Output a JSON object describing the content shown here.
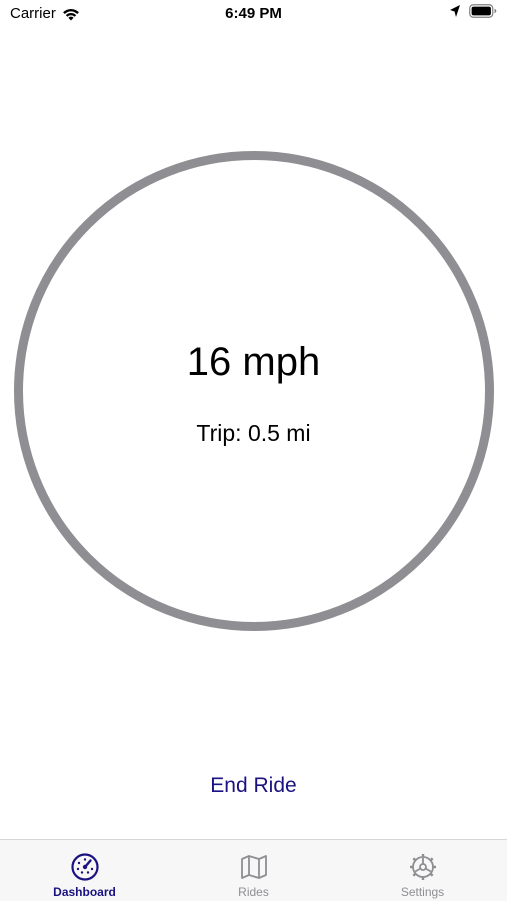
{
  "status_bar": {
    "carrier": "Carrier",
    "time": "6:49 PM"
  },
  "dashboard": {
    "speed": "16 mph",
    "trip": "Trip: 0.5 mi"
  },
  "actions": {
    "end_ride_label": "End Ride"
  },
  "tab_bar": {
    "tabs": [
      {
        "label": "Dashboard",
        "icon": "speedometer-icon",
        "active": true
      },
      {
        "label": "Rides",
        "icon": "map-icon",
        "active": false
      },
      {
        "label": "Settings",
        "icon": "gear-icon",
        "active": false
      }
    ]
  },
  "colors": {
    "accent": "#1a1280",
    "ring": "#8e8e93",
    "inactive": "#8e8e93"
  }
}
